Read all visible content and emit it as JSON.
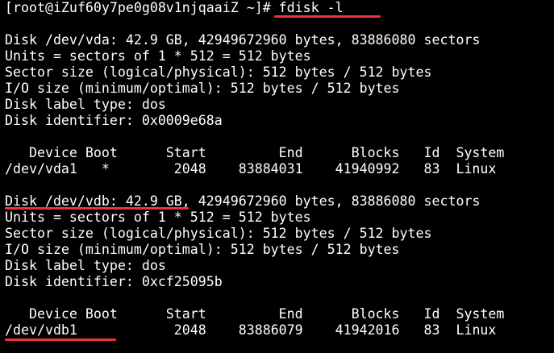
{
  "theme": {
    "background": "#000000",
    "foreground": "#ffffff",
    "annotation_color": "#e8343a"
  },
  "prompt": {
    "user_host": "[root@iZuf60y7pe0g08v1njqaaiZ ~]# ",
    "command": "fdisk -l"
  },
  "disk1": {
    "header": "Disk /dev/vda: 42.9 GB, 42949672960 bytes, 83886080 sectors",
    "units": "Units = sectors of 1 * 512 = 512 bytes",
    "sector_size": "Sector size (logical/physical): 512 bytes / 512 bytes",
    "io_size": "I/O size (minimum/optimal): 512 bytes / 512 bytes",
    "label_type": "Disk label type: dos",
    "identifier": "Disk identifier: 0x0009e68a",
    "table_header": "   Device Boot      Start         End      Blocks   Id  System",
    "partitions": [
      "/dev/vda1   *        2048    83884031    41940992   83  Linux"
    ]
  },
  "disk2": {
    "header_name": "Disk /dev/vdb: 42.9 GB",
    "header_rest": ", 42949672960 bytes, 83886080 sectors",
    "units": "Units = sectors of 1 * 512 = 512 bytes",
    "sector_size": "Sector size (logical/physical): 512 bytes / 512 bytes",
    "io_size": "I/O size (minimum/optimal): 512 bytes / 512 bytes",
    "label_type": "Disk label type: dos",
    "identifier": "Disk identifier: 0xcf25095b",
    "table_header": "   Device Boot      Start         End      Blocks   Id  System",
    "partition_device": "/dev/vdb1",
    "partition_rest": "            2048    83886079    41942016   83  Linux"
  }
}
